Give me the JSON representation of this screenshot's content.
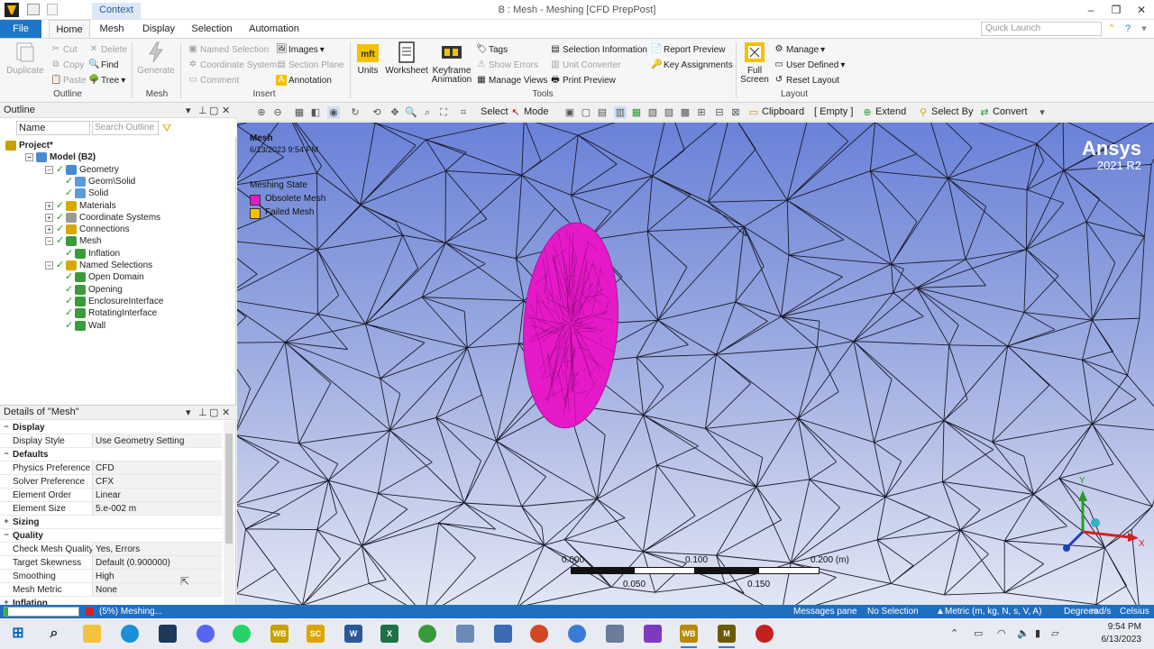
{
  "window": {
    "title": "B : Mesh - Meshing [CFD PrepPost]",
    "context_tab": "Context",
    "minimize": "–",
    "restore": "❐",
    "close": "✕"
  },
  "tabs": [
    {
      "label": "File"
    },
    {
      "label": "Home"
    },
    {
      "label": "Mesh"
    },
    {
      "label": "Display"
    },
    {
      "label": "Selection"
    },
    {
      "label": "Automation"
    }
  ],
  "quick_launch": {
    "placeholder": "Quick Launch"
  },
  "ribbon": {
    "outline": {
      "duplicate": "Duplicate",
      "cut": "Cut",
      "copy": "Copy",
      "paste": "Paste",
      "delete": "Delete",
      "find": "Find",
      "tree": "Tree",
      "group": "Outline"
    },
    "mesh": {
      "generate": "Generate",
      "group": "Mesh"
    },
    "insert": {
      "named_selection": "Named Selection",
      "coordinate_system": "Coordinate System",
      "comment": "Comment",
      "images": "Images",
      "section_plane": "Section Plane",
      "annotation": "Annotation",
      "group": "Insert"
    },
    "tools": {
      "units": "Units",
      "worksheet": "Worksheet",
      "keyframe": "Keyframe",
      "animation": "Animation",
      "tags": "Tags",
      "show_errors": "Show Errors",
      "manage_views": "Manage Views",
      "selection_information": "Selection Information",
      "unit_converter": "Unit Converter",
      "print_preview": "Print Preview",
      "report_preview": "Report Preview",
      "key_assignments": "Key Assignments",
      "group": "Tools"
    },
    "layout": {
      "full": "Full",
      "screen": "Screen",
      "manage": "Manage",
      "user_defined": "User Defined",
      "reset_layout": "Reset Layout",
      "group": "Layout"
    }
  },
  "outline": {
    "title": "Outline",
    "name_filter": "Name",
    "search_placeholder": "Search Outline",
    "tree": [
      {
        "label": "Project*",
        "depth": 0,
        "bold": true
      },
      {
        "label": "Model (B2)",
        "depth": 1,
        "bold": true
      },
      {
        "label": "Geometry",
        "depth": 2
      },
      {
        "label": "Geom\\Solid",
        "depth": 3
      },
      {
        "label": "Solid",
        "depth": 3
      },
      {
        "label": "Materials",
        "depth": 2
      },
      {
        "label": "Coordinate Systems",
        "depth": 2
      },
      {
        "label": "Connections",
        "depth": 2
      },
      {
        "label": "Mesh",
        "depth": 2
      },
      {
        "label": "Inflation",
        "depth": 3
      },
      {
        "label": "Named Selections",
        "depth": 2
      },
      {
        "label": "Open Domain",
        "depth": 3
      },
      {
        "label": "Opening",
        "depth": 3
      },
      {
        "label": "EnclosureInterface",
        "depth": 3
      },
      {
        "label": "RotatingInterface",
        "depth": 3
      },
      {
        "label": "Wall",
        "depth": 3
      }
    ]
  },
  "details": {
    "title": "Details of \"Mesh\"",
    "rows": [
      {
        "type": "cat",
        "label": "Display",
        "expand": "−"
      },
      {
        "type": "prop",
        "key": "Display Style",
        "value": "Use Geometry Setting"
      },
      {
        "type": "cat",
        "label": "Defaults",
        "expand": "−"
      },
      {
        "type": "prop",
        "key": "Physics Preference",
        "value": "CFD"
      },
      {
        "type": "prop",
        "key": "Solver Preference",
        "value": "CFX"
      },
      {
        "type": "prop",
        "key": "Element Order",
        "value": "Linear"
      },
      {
        "type": "prop",
        "key": "Element Size",
        "value": "5.e-002 m"
      },
      {
        "type": "cat",
        "label": "Sizing",
        "expand": "+"
      },
      {
        "type": "cat",
        "label": "Quality",
        "expand": "−"
      },
      {
        "type": "prop",
        "key": "Check Mesh Quality",
        "value": "Yes, Errors"
      },
      {
        "type": "prop",
        "key": "Target Skewness",
        "value": "Default (0.900000)"
      },
      {
        "type": "prop",
        "key": "Smoothing",
        "value": "High"
      },
      {
        "type": "prop",
        "key": "Mesh Metric",
        "value": "None"
      },
      {
        "type": "cat",
        "label": "Inflation",
        "expand": "+"
      }
    ]
  },
  "graphics_toolbar": {
    "select": "Select",
    "mode": "Mode",
    "clipboard": "Clipboard",
    "empty": "[ Empty ]",
    "extend": "Extend",
    "select_by": "Select By",
    "convert": "Convert"
  },
  "viewport": {
    "label": "Mesh",
    "date": "6/13/2023 9:54 PM",
    "legend_title": "Meshing State",
    "legend": [
      {
        "label": "Obsolete Mesh",
        "color": "#e619c8"
      },
      {
        "label": "Failed Mesh",
        "color": "#f2c200"
      }
    ],
    "brand": "Ansys",
    "version": "2021 R2",
    "scale": {
      "t0": "0.000",
      "t1": "0.100",
      "t2": "0.200 (m)",
      "b1": "0.050",
      "b2": "0.150"
    },
    "axis_x": "X",
    "axis_y": "Y"
  },
  "status": {
    "progress_text": "(5%) Meshing...",
    "progress_value": 0.05,
    "messages_pane": "Messages pane",
    "selection": "No Selection",
    "units": "Metric (m, kg, N, s, V, A)",
    "degrees": "Degrees",
    "rads": "rad/s",
    "celsius": "Celsius"
  },
  "taskbar": {
    "apps": [
      "WB",
      "SC",
      "W",
      "X",
      "WB",
      "M"
    ],
    "time": "9:54 PM",
    "date": "6/13/2023"
  },
  "colors": {
    "accent": "#1e76c9",
    "status_bar": "#1f6fc0",
    "obsolete_mesh": "#e619c8"
  }
}
